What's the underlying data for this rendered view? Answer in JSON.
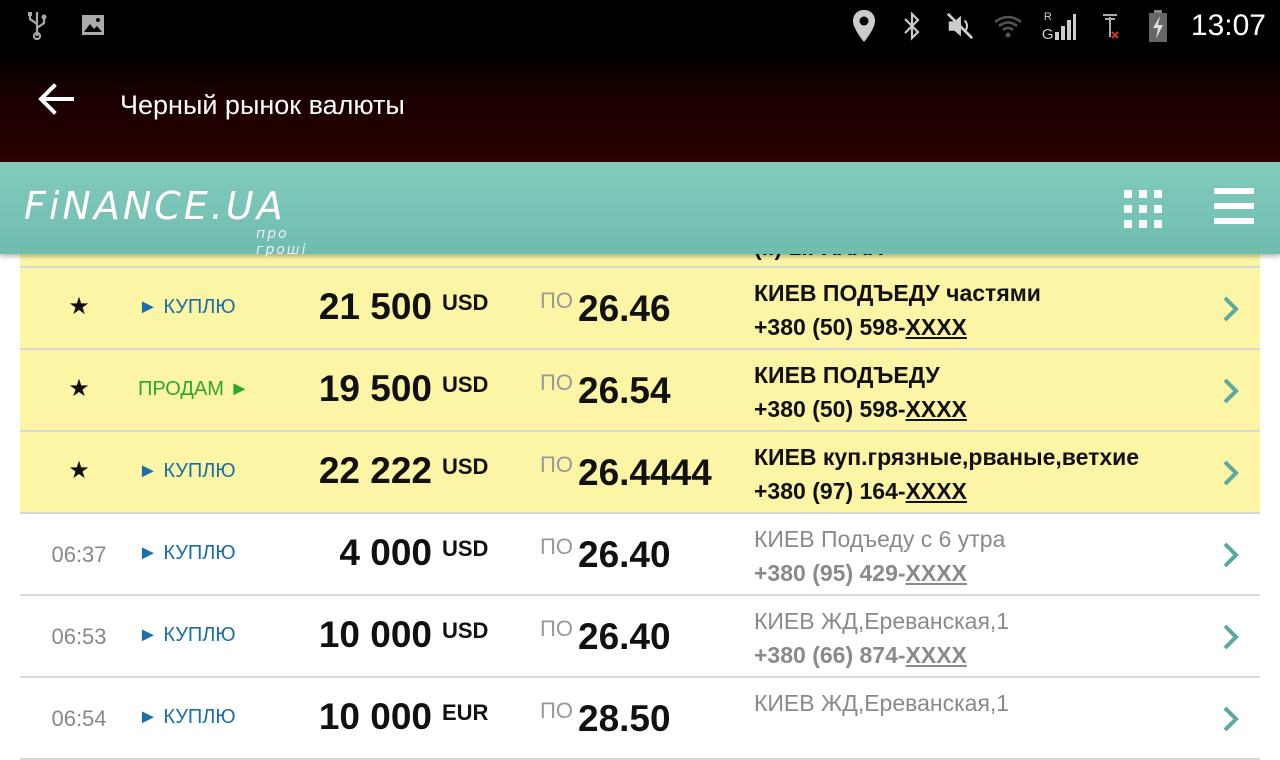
{
  "statusbar": {
    "clock": "13:07",
    "left_icons": [
      "usb-icon",
      "image-icon"
    ],
    "right_icons": [
      "location-icon",
      "bluetooth-icon",
      "mute-icon",
      "wifi-icon",
      "signal-icon",
      "no-signal-icon",
      "battery-icon"
    ],
    "signal_label_top": "R",
    "signal_label_bottom": "G"
  },
  "appbar": {
    "title": "Черный рынок валюты"
  },
  "finbar": {
    "logo_main": "FiNANCE.UA",
    "logo_sub": "про гроші"
  },
  "list": {
    "partial_row_text": "(..) 1..-XXXX",
    "rows": [
      {
        "type": "fav",
        "time": "",
        "action": "► КУПЛЮ",
        "amount": "21 500",
        "currency": "USD",
        "po": "ПО",
        "rate": "26.46",
        "desc": "КИЕВ ПОДЪЕДУ частями",
        "phone_prefix": "+380 (50) 598-",
        "phone_masked": "XXXX"
      },
      {
        "type": "fav",
        "time": "",
        "action": "ПРОДАМ ►",
        "amount": "19 500",
        "currency": "USD",
        "po": "ПО",
        "rate": "26.54",
        "desc": "КИЕВ ПОДЪЕДУ",
        "phone_prefix": "+380 (50) 598-",
        "phone_masked": "XXXX"
      },
      {
        "type": "fav",
        "time": "",
        "action": "► КУПЛЮ",
        "amount": "22 222",
        "currency": "USD",
        "po": "ПО",
        "rate": "26.4444",
        "desc": "КИЕВ куп.грязные,рваные,ветхие",
        "phone_prefix": "+380 (97) 164-",
        "phone_masked": "XXXX"
      },
      {
        "type": "plain",
        "time": "06:37",
        "action": "► КУПЛЮ",
        "amount": "4 000",
        "currency": "USD",
        "po": "ПО",
        "rate": "26.40",
        "desc": "КИЕВ Подъеду с 6 утра",
        "phone_prefix": "+380 (95) 429-",
        "phone_masked": "XXXX"
      },
      {
        "type": "plain",
        "time": "06:53",
        "action": "► КУПЛЮ",
        "amount": "10 000",
        "currency": "USD",
        "po": "ПО",
        "rate": "26.40",
        "desc": "КИЕВ ЖД,Ереванская,1",
        "phone_prefix": "+380 (66) 874-",
        "phone_masked": "XXXX"
      },
      {
        "type": "plain",
        "time": "06:54",
        "action": "► КУПЛЮ",
        "amount": "10 000",
        "currency": "EUR",
        "po": "ПО",
        "rate": "28.50",
        "desc": "КИЕВ ЖД,Ереванская,1",
        "phone_prefix": "",
        "phone_masked": ""
      }
    ]
  },
  "colors": {
    "fav_row_bg": "#fdf5a6",
    "buy_color": "#1b6fa6",
    "sell_color": "#2aa82a",
    "finbar_bg": "#7bc6b8",
    "chevron": "#5aa8a0"
  }
}
